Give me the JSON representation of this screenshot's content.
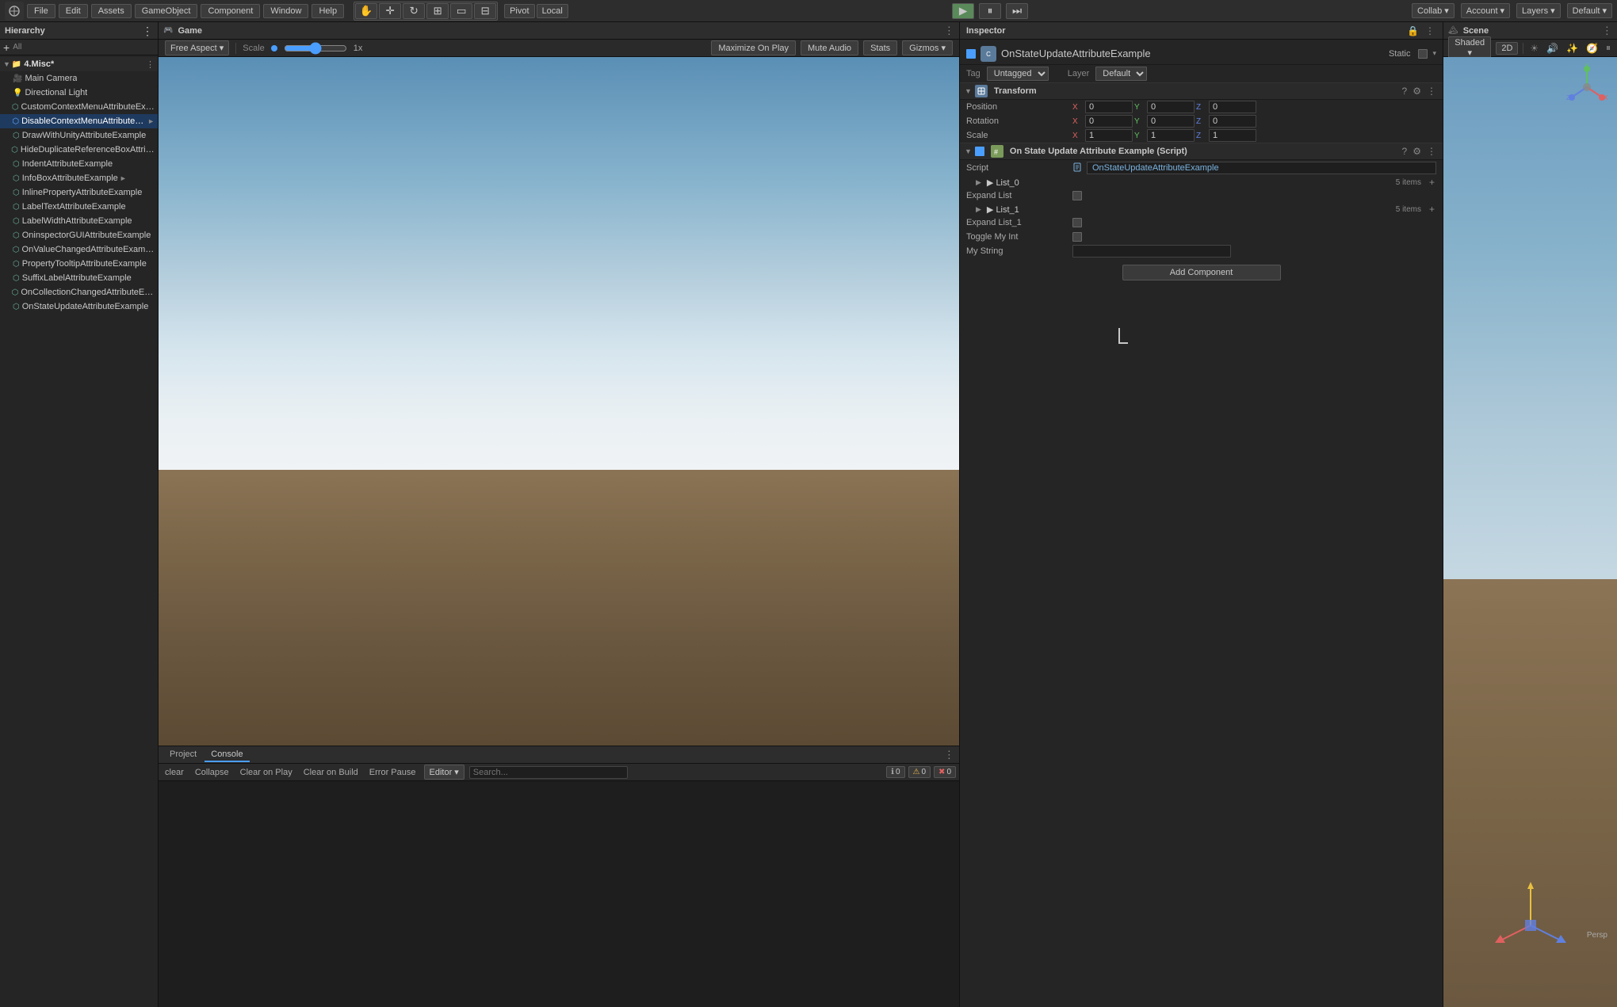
{
  "topbar": {
    "collab_label": "Collab",
    "account_label": "Account",
    "layers_label": "Layers",
    "default_label": "Default",
    "pivot_btn": "Pivot",
    "local_btn": "Local",
    "play_btn": "▶",
    "pause_btn": "⏸",
    "step_btn": "⏭"
  },
  "hierarchy": {
    "title": "Hierarchy",
    "all_label": "All",
    "items": [
      {
        "name": "4.Misc*",
        "depth": 0,
        "icon": "📁",
        "arrow": "▼",
        "selected": false,
        "category": true
      },
      {
        "name": "Main Camera",
        "depth": 1,
        "icon": "🎥",
        "arrow": "",
        "selected": false
      },
      {
        "name": "Directional Light",
        "depth": 1,
        "icon": "💡",
        "arrow": "",
        "selected": false
      },
      {
        "name": "CustomContextMenuAttributeExample",
        "depth": 1,
        "icon": "⬡",
        "arrow": "",
        "selected": false
      },
      {
        "name": "DisableContextMenuAttributeEx...",
        "depth": 1,
        "icon": "⬡",
        "arrow": "►",
        "selected": true,
        "highlighted": true
      },
      {
        "name": "DrawWithUnityAttributeExample",
        "depth": 1,
        "icon": "⬡",
        "arrow": "",
        "selected": false
      },
      {
        "name": "HideDuplicateReferenceBoxAttributeEx...",
        "depth": 1,
        "icon": "⬡",
        "arrow": "",
        "selected": false
      },
      {
        "name": "IndentAttributeExample",
        "depth": 1,
        "icon": "⬡",
        "arrow": "",
        "selected": false
      },
      {
        "name": "InfoBoxAttributeExample",
        "depth": 1,
        "icon": "⬡",
        "arrow": "►",
        "selected": false
      },
      {
        "name": "InlinePropertyAttributeExample",
        "depth": 1,
        "icon": "⬡",
        "arrow": "",
        "selected": false
      },
      {
        "name": "LabelTextAttributeExample",
        "depth": 1,
        "icon": "⬡",
        "arrow": "",
        "selected": false
      },
      {
        "name": "LabelWidthAttributeExample",
        "depth": 1,
        "icon": "⬡",
        "arrow": "",
        "selected": false
      },
      {
        "name": "OninspectorGUIAttributeExample",
        "depth": 1,
        "icon": "⬡",
        "arrow": "",
        "selected": false
      },
      {
        "name": "OnValueChangedAttributeExample",
        "depth": 1,
        "icon": "⬡",
        "arrow": "",
        "selected": false
      },
      {
        "name": "PropertyTooltipAttributeExample",
        "depth": 1,
        "icon": "⬡",
        "arrow": "",
        "selected": false
      },
      {
        "name": "SuffixLabelAttributeExample",
        "depth": 1,
        "icon": "⬡",
        "arrow": "",
        "selected": false
      },
      {
        "name": "OnCollectionChangedAttributeExample",
        "depth": 1,
        "icon": "⬡",
        "arrow": "",
        "selected": false
      },
      {
        "name": "OnStateUpdateAttributeExample",
        "depth": 1,
        "icon": "⬡",
        "arrow": "",
        "selected": false
      }
    ]
  },
  "game_view": {
    "title": "Game",
    "aspect_label": "Free Aspect",
    "scale_label": "Scale",
    "scale_value": "1x",
    "maximize_btn": "Maximize On Play",
    "mute_btn": "Mute Audio",
    "stats_btn": "Stats",
    "gizmos_btn": "Gizmos"
  },
  "inspector": {
    "title": "Inspector",
    "object_name": "OnStateUpdateAttributeExample",
    "tag_label": "Tag",
    "tag_value": "Untagged",
    "layer_label": "Layer",
    "layer_value": "Default",
    "static_label": "Static",
    "transform_title": "Transform",
    "position_label": "Position",
    "pos_x": "0",
    "pos_y": "0",
    "pos_z": "0",
    "rotation_label": "Rotation",
    "rot_x": "0",
    "rot_y": "0",
    "rot_z": "0",
    "scale_label": "Scale",
    "scale_x": "1",
    "scale_y": "1",
    "scale_z": "1",
    "script_component_title": "On State Update Attribute Example (Script)",
    "script_label": "Script",
    "script_value": "OnStateUpdateAttributeExample",
    "list0_label": "▶ List_0",
    "list0_count": "5 items",
    "expand_list_label": "Expand List",
    "list1_label": "▶ List_1",
    "list1_count": "5 items",
    "expand_list1_label": "Expand List_1",
    "toggle_label": "Toggle My Int",
    "my_string_label": "My String",
    "add_component_btn": "Add Component"
  },
  "scene_view": {
    "title": "Scene",
    "shading_label": "Shaded",
    "mode_2d": "2D",
    "persp_label": "Persp"
  },
  "console": {
    "project_tab": "Project",
    "console_tab": "Console",
    "clear_btn": "clear",
    "collapse_btn": "Collapse",
    "clear_on_play_btn": "Clear on Play",
    "clear_on_build_btn": "Clear on Build",
    "error_pause_btn": "Error Pause",
    "editor_btn": "Editor",
    "count_0": "0",
    "count_1": "0",
    "count_2": "0"
  },
  "colors": {
    "bg_main": "#1a1a1a",
    "bg_panel": "#252525",
    "bg_toolbar": "#2d2d2d",
    "accent_blue": "#4a9eff",
    "selected_blue": "#2c5282"
  }
}
